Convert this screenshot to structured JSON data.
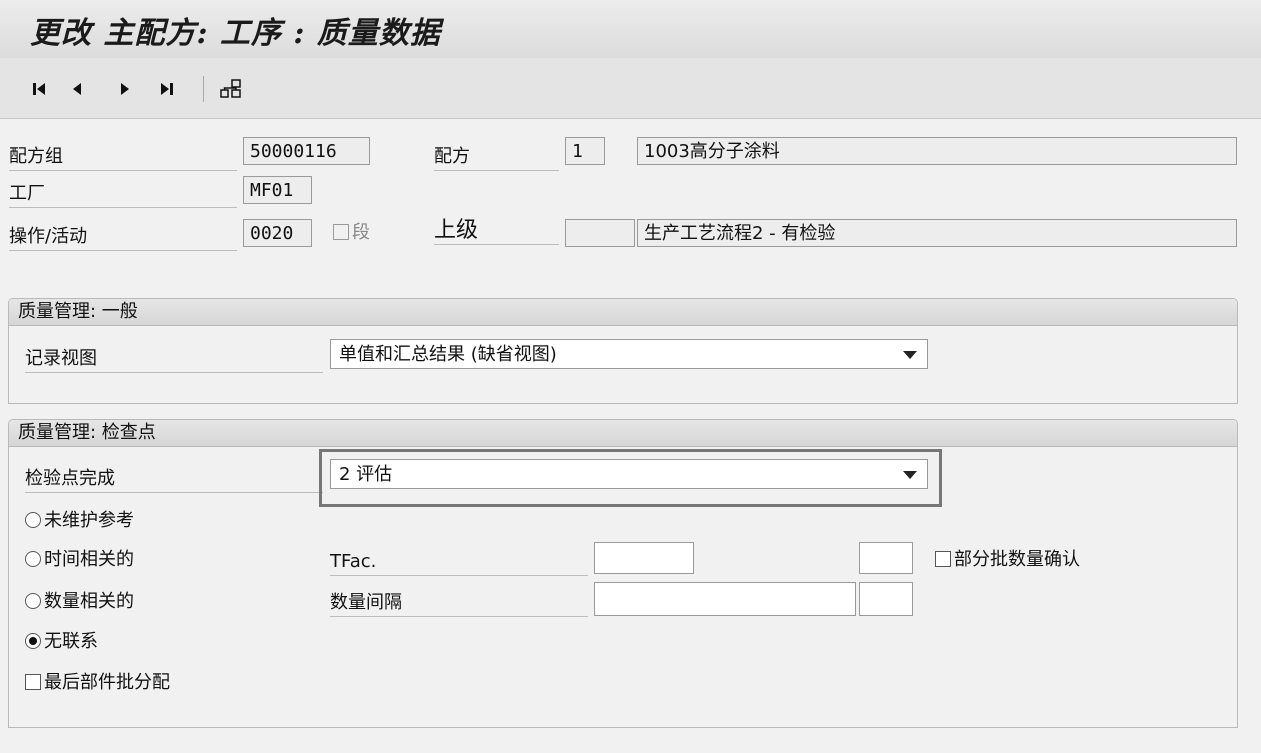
{
  "header": {
    "title": "更改 主配方: 工序 : 质量数据"
  },
  "toolbar": {
    "first_icon": "first-page-icon",
    "prev_icon": "previous-page-icon",
    "next_icon": "next-page-icon",
    "last_icon": "last-page-icon",
    "hierarchy_icon": "hierarchy-icon"
  },
  "recipe": {
    "group_label": "配方组",
    "group_value": "50000116",
    "recipe_label": "配方",
    "recipe_value": "1",
    "recipe_desc": "1003高分子涂料",
    "plant_label": "工厂",
    "plant_value": "MF01",
    "op_label": "操作/活动",
    "op_value": "0020",
    "phase_label": "段",
    "superior_label": "上级",
    "superior_value": "",
    "superior_desc": "生产工艺流程2 - 有检验"
  },
  "qm_general": {
    "title": "质量管理: 一般",
    "record_view_label": "记录视图",
    "record_view_value": "单值和汇总结果 (缺省视图)"
  },
  "qm_inspection": {
    "title": "质量管理: 检查点",
    "completion_label": "检验点完成",
    "completion_value": "2 评估",
    "radio_no_ref": "未维护参考",
    "radio_time": "时间相关的",
    "radio_qty": "数量相关的",
    "radio_none": "无联系",
    "selected_radio": "无联系",
    "last_batch_label": "最后部件批分配",
    "tfac_label": "TFac.",
    "tfac_value": "",
    "tfac_unit": "",
    "qty_interval_label": "数量间隔",
    "qty_interval_value": "",
    "qty_interval_unit": "",
    "partial_lot_label": "部分批数量确认"
  },
  "colors": {
    "highlight_border": "#777777"
  }
}
